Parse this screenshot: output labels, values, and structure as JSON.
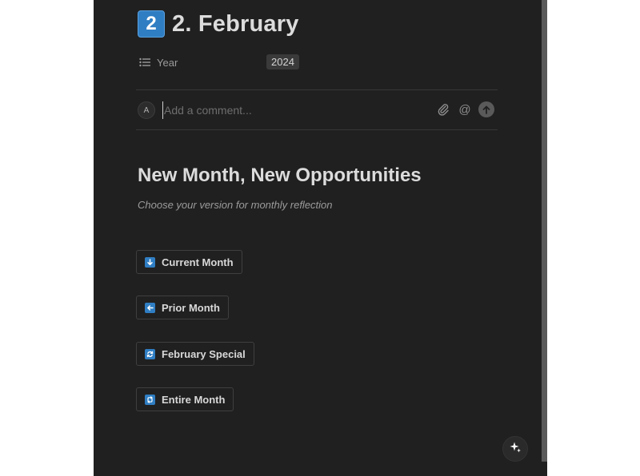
{
  "page": {
    "title_emoji": "2",
    "title": "2. February"
  },
  "property": {
    "icon": "list-icon",
    "label": "Year",
    "value": "2024"
  },
  "comment": {
    "avatar_initial": "A",
    "placeholder": "Add a comment...",
    "actions": [
      "attach-icon",
      "mention-icon",
      "send-icon"
    ]
  },
  "section": {
    "heading": "New Month, New Opportunities",
    "subtitle": "Choose your version for monthly reflection"
  },
  "buttons": [
    {
      "label": "Current Month",
      "icon": "arrow-down-icon"
    },
    {
      "label": "Prior Month",
      "icon": "arrow-left-icon"
    },
    {
      "label": "February Special",
      "icon": "refresh-icon"
    },
    {
      "label": "Entire Month",
      "icon": "repeat-icon"
    }
  ],
  "colors": {
    "page_background": "#202020",
    "accent_blue": "#2f7ec3"
  }
}
